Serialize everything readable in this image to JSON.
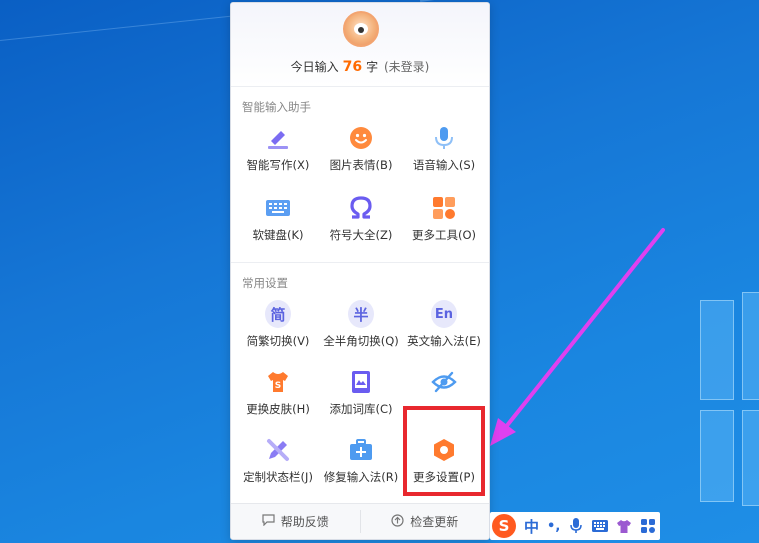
{
  "panel": {
    "stat": {
      "prefix": "今日输入",
      "count": "76",
      "suffix": "字",
      "login": "(未登录)"
    },
    "section1_title": "智能输入助手",
    "section2_title": "常用设置",
    "assist_items": [
      {
        "label": "智能写作(X)",
        "icon": "pen-icon"
      },
      {
        "label": "图片表情(B)",
        "icon": "smiley-icon"
      },
      {
        "label": "语音输入(S)",
        "icon": "microphone-icon"
      },
      {
        "label": "软键盘(K)",
        "icon": "keyboard-icon"
      },
      {
        "label": "符号大全(Z)",
        "icon": "omega-icon"
      },
      {
        "label": "更多工具(O)",
        "icon": "apps-grid-icon"
      }
    ],
    "settings_items": [
      {
        "label": "简繁切换(V)",
        "glyph": "简",
        "icon": "simplified-traditional-icon"
      },
      {
        "label": "全半角切换(Q)",
        "glyph": "半",
        "icon": "half-width-icon"
      },
      {
        "label": "英文输入法(E)",
        "glyph": "En",
        "icon": "english-input-icon"
      },
      {
        "label": "更换皮肤(H)",
        "icon": "shirt-icon"
      },
      {
        "label": "添加词库(C)",
        "icon": "dictionary-icon"
      },
      {
        "label": "",
        "icon": "eye-hidden-icon"
      },
      {
        "label": "定制状态栏(J)",
        "icon": "pencil-ruler-icon"
      },
      {
        "label": "修复输入法(R)",
        "icon": "toolbox-icon"
      },
      {
        "label": "更多设置(P)",
        "icon": "settings-hexagon-icon"
      }
    ],
    "footer": {
      "help": "帮助反馈",
      "update": "检查更新"
    }
  },
  "imebar": {
    "logo": "S",
    "lang": "中",
    "punc": "•,",
    "icons": [
      "microphone-icon",
      "keyboard-icon",
      "shirt-icon",
      "apps-grid-icon"
    ]
  },
  "colors": {
    "accent_orange": "#ff6a00",
    "purple": "#6a5cf0",
    "highlight_red": "#e8282e",
    "arrow_magenta": "#e040f0"
  }
}
